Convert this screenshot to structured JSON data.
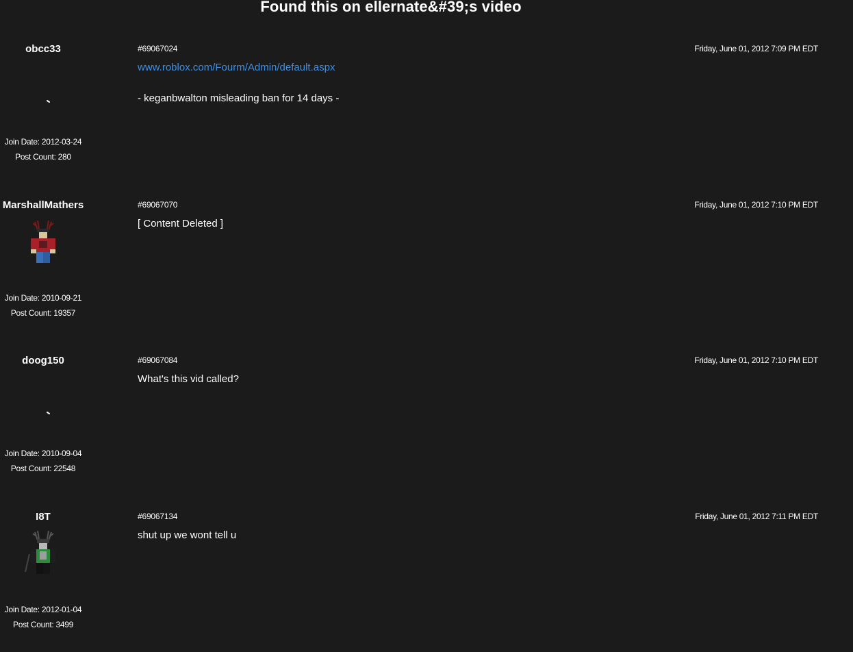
{
  "thread": {
    "title": "Found this on ellernate&#39;s video"
  },
  "posts": [
    {
      "username": "obcc33",
      "avatar_icon": "blank-avatar-icon",
      "join_date": "Join Date: 2012-03-24",
      "post_count": "Post Count: 280",
      "post_id": "#69067024",
      "date": "Friday, June 01, 2012 7:09 PM EDT",
      "link": "www.roblox.com/Fourm/Admin/default.aspx",
      "text": "- keganbwalton misleading ban for 14 days -"
    },
    {
      "username": "MarshallMathers",
      "avatar_icon": "antlered-robloxian-red-shirt-avatar-icon",
      "join_date": "Join Date: 2010-09-21",
      "post_count": "Post Count: 19357",
      "post_id": "#69067070",
      "date": "Friday, June 01, 2012 7:10 PM EDT",
      "text": "[ Content Deleted ]"
    },
    {
      "username": "doog150",
      "avatar_icon": "blank-avatar-icon",
      "join_date": "Join Date: 2010-09-04",
      "post_count": "Post Count: 22548",
      "post_id": "#69067084",
      "date": "Friday, June 01, 2012 7:10 PM EDT",
      "text": "What's this vid called?"
    },
    {
      "username": "I8T",
      "avatar_icon": "antlered-robloxian-green-shirt-avatar-icon",
      "join_date": "Join Date: 2012-01-04",
      "post_count": "Post Count: 3499",
      "post_id": "#69067134",
      "date": "Friday, June 01, 2012 7:11 PM EDT",
      "text": "shut up we wont tell u"
    }
  ],
  "colors": {
    "background": "#1b1b1c",
    "text": "#ffffff",
    "link": "#3d8fe6"
  }
}
